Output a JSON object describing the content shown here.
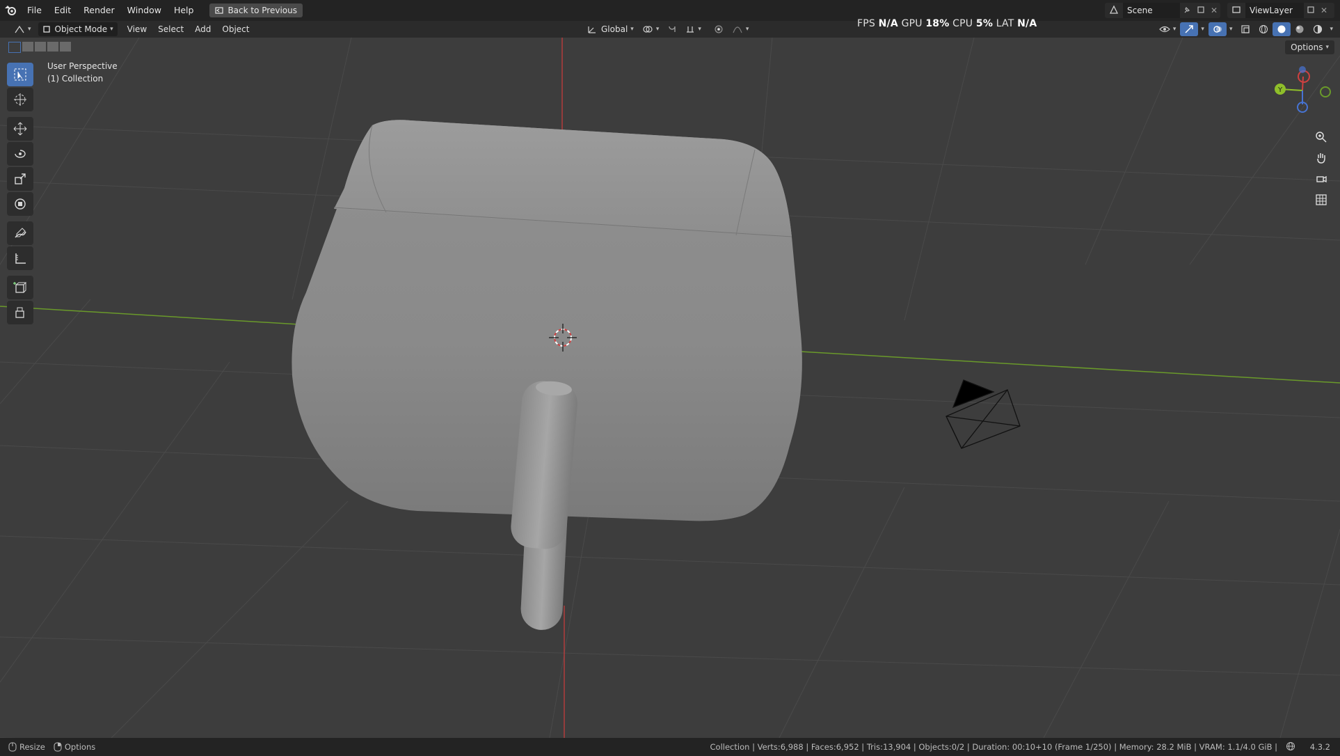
{
  "menu": {
    "items": [
      "File",
      "Edit",
      "Render",
      "Window",
      "Help"
    ],
    "back_button": "Back to Previous"
  },
  "scene": {
    "label": "Scene"
  },
  "view_layer": {
    "label": "ViewLayer"
  },
  "header": {
    "mode": "Object Mode",
    "view": "View",
    "select": "Select",
    "add": "Add",
    "object": "Object",
    "transform_orientation": "Global",
    "options": "Options"
  },
  "hud": {
    "fps_label": "FPS",
    "fps_value": "N/A",
    "gpu_label": "GPU",
    "gpu_value": "18%",
    "cpu_label": "CPU",
    "cpu_value": "5%",
    "lat_label": "LAT",
    "lat_value": "N/A"
  },
  "viewport": {
    "perspective": "User Perspective",
    "collection": "(1) Collection"
  },
  "statusbar": {
    "resize": "Resize",
    "options": "Options",
    "stats": "Collection | Verts:6,988 | Faces:6,952 | Tris:13,904 | Objects:0/2 | Duration: 00:10+10 (Frame 1/250) | Memory: 28.2 MiB | VRAM: 1.1/4.0 GiB |",
    "version": "4.3.2"
  },
  "icons": [
    "blender-logo-icon",
    "select-box-icon",
    "cursor-icon",
    "move-icon",
    "rotate-icon",
    "scale-icon",
    "transform-icon",
    "annotate-icon",
    "measure-icon",
    "add-cube-icon",
    "extrude-icon",
    "zoom-icon",
    "hand-pan-icon",
    "camera-view-icon",
    "grid-view-icon"
  ],
  "colors": {
    "viewport_bg": "#3d3d3d",
    "active_tool": "#4772b3",
    "axis_x": "#c43c3c",
    "axis_y": "#6a9a2a"
  }
}
